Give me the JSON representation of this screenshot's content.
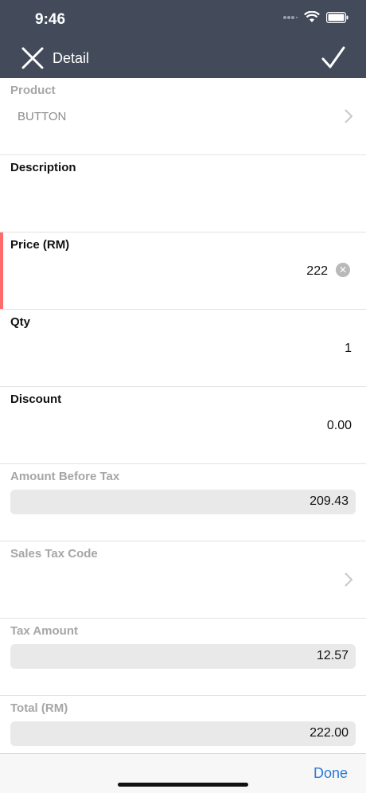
{
  "status_bar": {
    "time": "9:46"
  },
  "nav": {
    "title": "Detail",
    "close_icon": "close-icon",
    "confirm_icon": "checkmark-icon"
  },
  "fields": {
    "product": {
      "label": "Product",
      "value": "BUTTON"
    },
    "description": {
      "label": "Description",
      "value": ""
    },
    "price": {
      "label": "Price (RM)",
      "value": "222"
    },
    "qty": {
      "label": "Qty",
      "value": "1"
    },
    "discount": {
      "label": "Discount",
      "value": "0.00"
    },
    "amount_before_tax": {
      "label": "Amount Before Tax",
      "value": "209.43"
    },
    "sales_tax_code": {
      "label": "Sales Tax Code",
      "value": ""
    },
    "tax_amount": {
      "label": "Tax Amount",
      "value": "12.57"
    },
    "total": {
      "label": "Total (RM)",
      "value": "222.00"
    }
  },
  "toolbar": {
    "done_label": "Done"
  },
  "colors": {
    "nav_bg": "#434b5b",
    "accent_error": "#ff6b6b",
    "link_blue": "#2b7bd6"
  }
}
